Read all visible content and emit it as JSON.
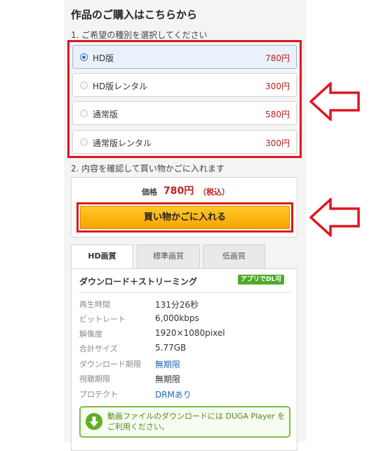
{
  "purchase": {
    "title": "作品のご購入はこちらから",
    "step1": "1. ご希望の種別を選択してください",
    "step2": "2. 内容を確認して買い物かごに入れます",
    "options": [
      {
        "name": "HD版",
        "price": "780円",
        "selected": true
      },
      {
        "name": "HD版レンタル",
        "price": "300円",
        "selected": false
      },
      {
        "name": "通常版",
        "price": "580円",
        "selected": false
      },
      {
        "name": "通常版レンタル",
        "price": "300円",
        "selected": false
      }
    ],
    "price_label": "価格",
    "price_value": "780円",
    "price_tax": "（税込）",
    "cart_button": "買い物かごに入れる"
  },
  "quality_tabs": [
    {
      "label": "HD画質",
      "active": true
    },
    {
      "label": "標準画質",
      "active": false
    },
    {
      "label": "低画質",
      "active": false
    }
  ],
  "detail": {
    "title": "ダウンロード＋ストリーミング",
    "app_badge": "アプリでDL可",
    "specs": [
      {
        "label": "再生時間",
        "value": "131分26秒",
        "link": false
      },
      {
        "label": "ビットレート",
        "value": "6,000kbps",
        "link": false
      },
      {
        "label": "解像度",
        "value": "1920×1080pixel",
        "link": false
      },
      {
        "label": "合計サイズ",
        "value": "5.77GB",
        "link": false
      },
      {
        "label": "ダウンロード期限",
        "value": "無期限",
        "link": true
      },
      {
        "label": "視聴期限",
        "value": "無期限",
        "link": false
      },
      {
        "label": "プロテクト",
        "value": "DRMあり",
        "link": true
      }
    ],
    "notice": "動画ファイルのダウンロードには DUGA Player をご利用ください。"
  },
  "colors": {
    "price_red": "#c0201e",
    "annotation_red": "#e0161e",
    "button_orange": "#f6a400",
    "notice_green": "#7ac143"
  }
}
